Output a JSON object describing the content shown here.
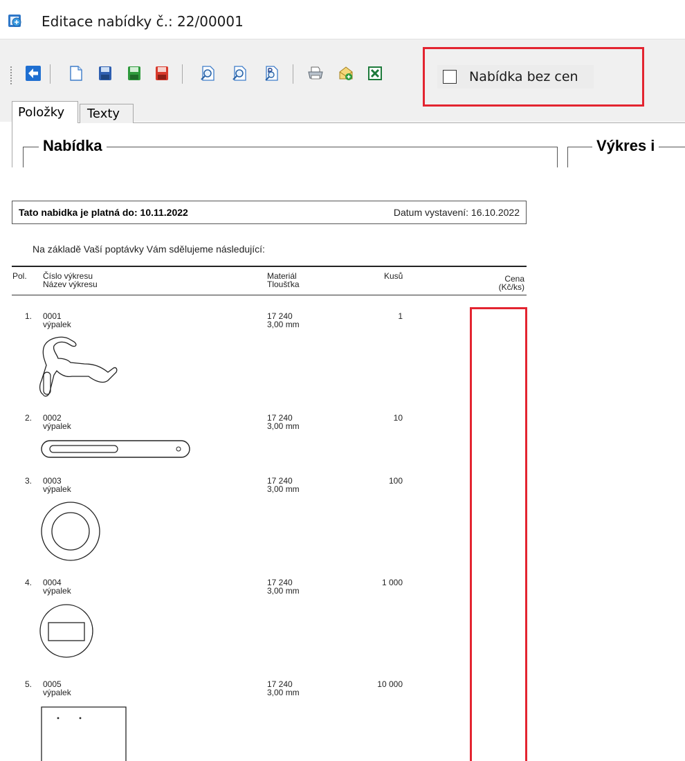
{
  "window": {
    "title": "Editace nabídky č.: 22/00001",
    "icon": "app-icon"
  },
  "toolbar": {
    "buttons": [
      {
        "name": "back-icon"
      },
      {
        "name": "new-document-icon"
      },
      {
        "name": "save-icon"
      },
      {
        "name": "save-green-icon"
      },
      {
        "name": "save-red-icon"
      },
      {
        "name": "preview-icon"
      },
      {
        "name": "preview-2-icon"
      },
      {
        "name": "pdf-preview-icon"
      },
      {
        "name": "print-icon"
      },
      {
        "name": "email-icon"
      },
      {
        "name": "excel-icon"
      }
    ],
    "no_price_checkbox": {
      "label": "Nabídka bez cen",
      "checked": false
    },
    "highlight_color": "#e32430"
  },
  "tabs": [
    {
      "label": "Položky",
      "active": true
    },
    {
      "label": "Texty",
      "active": false
    }
  ],
  "groups": {
    "offer": "Nabídka",
    "drawing": "Výkres i"
  },
  "report": {
    "validity": "Tato nabidka je platná do: 10.11.2022",
    "issue_date": "Datum vystavení: 16.10.2022",
    "intro": "Na základě Vaší poptávky Vám sdělujeme následující:",
    "columns": {
      "pos": "Pol.",
      "drawing_no": "Číslo výkresu",
      "drawing_name": "Název výkresu",
      "material": "Materiál",
      "thickness": "Tloušťka",
      "qty": "Kusů",
      "price": "Cena",
      "price_unit": "(Kč/ks)"
    },
    "rows": [
      {
        "pos": "1.",
        "number": "0001",
        "name": "výpalek",
        "material": "17 240",
        "thickness": "3,00 mm",
        "qty": "1"
      },
      {
        "pos": "2.",
        "number": "0002",
        "name": "výpalek",
        "material": "17 240",
        "thickness": "3,00 mm",
        "qty": "10"
      },
      {
        "pos": "3.",
        "number": "0003",
        "name": "výpalek",
        "material": "17 240",
        "thickness": "3,00 mm",
        "qty": "100"
      },
      {
        "pos": "4.",
        "number": "0004",
        "name": "výpalek",
        "material": "17 240",
        "thickness": "3,00 mm",
        "qty": "1 000"
      },
      {
        "pos": "5.",
        "number": "0005",
        "name": "výpalek",
        "material": "17 240",
        "thickness": "3,00 mm",
        "qty": "10 000"
      }
    ]
  }
}
